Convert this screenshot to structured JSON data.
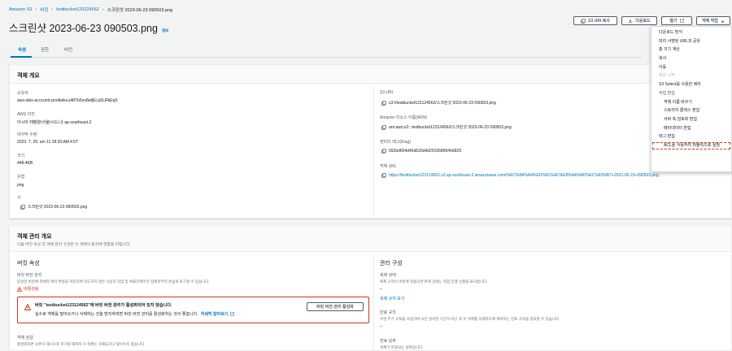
{
  "breadcrumb": {
    "items": [
      "Amazon S3",
      "버킷",
      "testbucket123124562"
    ],
    "current": "스크린샷 2023-06-23 090503.png"
  },
  "header": {
    "title": "스크린샷 2023-06-23 090503.png",
    "info": "정보",
    "copy_uri": "S3 URI 복사",
    "download": "다운로드",
    "open": "열기",
    "actions": "객체 작업"
  },
  "tabs": {
    "properties": "속성",
    "permissions": "권한",
    "versions": "버전"
  },
  "overview": {
    "title": "객체 개요",
    "owner_label": "소유자",
    "owner_value": "aws-labs-accountr-prodleiku-j4RTo5es8efjELqSLRkEqS",
    "region_label": "AWS 리전",
    "region_value": "아시아 태평양(서울/시드니) ap-southeast-2",
    "modified_label": "마지막 수정",
    "modified_value": "2023. 7. 29. am 11:18:30 AM KST",
    "size_label": "크기",
    "size_value": "448.4KB",
    "type_label": "유형",
    "type_value": "png",
    "key_label": "키",
    "key_value": "스크린샷 2023-06-23 090503.png",
    "s3uri_label": "S3 URI",
    "s3uri_value": "s3://testbucket123124562/스크린샷 2023-06-23 090503.png",
    "arn_label": "Amazon 리소스 이름(ARN)",
    "arn_value": "arn:aws:s3:::testbucket123124562/스크린샷 2023-06-23 090503.png",
    "etag_label": "엔터티 태그(Etag)",
    "etag_value": "692bd604d45d533d4d2910689940d929",
    "url_label": "객체 URL",
    "url_value": "https://testbucket123124562.s3.ap-southeast-2.amazonaws.com/%EC%8A%A4%ED%81%AC%EB%A6%B0%EC%83%B7+2023-06-23+090503.png"
  },
  "management": {
    "title": "객체 관리 개요",
    "subtitle": "다음 버킷 속성 및 객체 관리 구성은 이 객체의 동작에 영향을 미칩니다.",
    "bucket_props": "버킷 속성",
    "versioning_label": "버킷 버전 관리",
    "versioning_desc": "동일한 버킷에 객체의 여러 변형을 저장하여 의도하지 않은 사용자 작업 및 애플리케이션 장애로부터 손쉽게 복구할 수 있습니다.",
    "versioning_status": "비활성됨",
    "alert_title": "버킷 \"testbucket123124562\"에 버킷 버전 관리가 활성화되어 있지 않습니다.",
    "alert_body": "실수로 객체를 덮어쓰거나 삭제하는 것을 방지하려면 버킷 버전 관리를 활성화하는 것이 좋습니다.",
    "alert_link": "자세히 알아보기",
    "enable_versioning": "버킷 버전 관리 활성화",
    "expiry_label": "객체 잠금",
    "expiry_desc": "활성화하면 보존이 해시으로 저거될 때까지 이 객체는 삭제되거나 덮어쓰지 않습니다.",
    "mgmt_config": "관리 구성",
    "replication_label": "복제 상태",
    "replication_desc": "복제 규칙이 버킷에 적용되면 복제 상태는 작업 진행 상황을 표시합니다.",
    "replication_value": "–",
    "replication_link": "복제 규칙 보기",
    "lifecycle_label": "만료 규칙",
    "lifecycle_desc": "수명 주기 규칙을 사용하여 사전 정의된 기간이 지난 후 이 객체를 삭제하도록 예약하는 만료 규칙을 정의할 수 있습니다.",
    "lifecycle_value": "–",
    "expiry_date_label": "만료 날짜",
    "expiry_date_desc": "객체가 만료되는 날짜입니다."
  },
  "menu": {
    "items": [
      {
        "label": "다운로드 방식",
        "disabled": false,
        "style": "normal"
      },
      {
        "label": "미리 서명된 URL과 공유",
        "disabled": false,
        "style": "normal"
      },
      {
        "label": "총 크기 계산",
        "disabled": false,
        "style": "normal"
      },
      {
        "label": "복사",
        "disabled": false,
        "style": "normal"
      },
      {
        "label": "이동",
        "disabled": false,
        "style": "normal"
      },
      {
        "label": "복원 시작",
        "disabled": true,
        "style": "normal"
      },
      {
        "label": "S3 Select를 사용한 쿼리",
        "disabled": false,
        "style": "normal"
      },
      {
        "label": "작업 편집",
        "disabled": false,
        "style": "group"
      },
      {
        "label": "객체 이름 바꾸기",
        "disabled": false,
        "style": "sub"
      },
      {
        "label": "스토리지 클래스 편집",
        "disabled": false,
        "style": "sub"
      },
      {
        "label": "서버 측 암호화 편집",
        "disabled": false,
        "style": "sub"
      },
      {
        "label": "메타데이터 편집",
        "disabled": false,
        "style": "sub"
      },
      {
        "label": "태그 편집",
        "disabled": false,
        "style": "normal"
      },
      {
        "label": "ACL을 사용하여 퍼블릭으로 설정",
        "disabled": false,
        "style": "sub",
        "selected": true
      }
    ]
  },
  "colors": {
    "accent": "#0073bb",
    "warning": "#d13212",
    "orange": "#ec7211",
    "selection": "#d13212"
  }
}
